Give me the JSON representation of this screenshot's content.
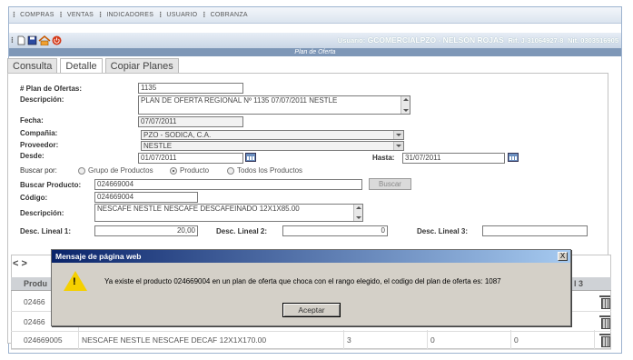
{
  "menu": [
    "COMPRAS",
    "VENTAS",
    "INDICADORES",
    "USUARIO",
    "COBRANZA"
  ],
  "toolbar": {
    "icons": [
      "new-document-icon",
      "save-icon",
      "home-icon",
      "power-icon"
    ]
  },
  "header": {
    "user_label": "Usuario:",
    "user": "GCOMERCIALPZO - NELSÓN ROJAS",
    "rif": "Rif. J-31064927-8",
    "nit": "Nit. 0303516905"
  },
  "page_title": "Plan de Oferta",
  "tabs": [
    "Consulta",
    "Detalle",
    "Copiar Planes"
  ],
  "form": {
    "plan_label": "# Plan de Ofertas:",
    "plan_value": "1135",
    "desc_label": "Descripción:",
    "desc_value": "PLAN DE OFERTA REGIONAL Nº 1135 07/07/2011 NESTLE",
    "fecha_label": "Fecha:",
    "fecha_value": "07/07/2011",
    "compania_label": "Compañia:",
    "compania_value": "PZO - SODICA, C.A.",
    "proveedor_label": "Proveedor:",
    "proveedor_value": "NESTLE",
    "desde_label": "Desde:",
    "desde_value": "01/07/2011",
    "hasta_label": "Hasta:",
    "hasta_value": "31/07/2011",
    "buscar_por_label": "Buscar por:",
    "radio_grupo": "Grupo de Productos",
    "radio_producto": "Producto",
    "radio_todos": "Todos los Productos",
    "buscar_prod_label": "Buscar Producto:",
    "buscar_prod_value": "024669004",
    "buscar_button": "Buscar",
    "codigo_label": "Código:",
    "codigo_value": "024669004",
    "desc2_label": "Descripción:",
    "desc2_value": "NESCAFE NESTLE NESCAFE DESCAFEINADO 12X1X85.00",
    "dl1_label": "Desc. Lineal 1:",
    "dl1_value": "20,00",
    "dl2_label": "Desc. Lineal 2:",
    "dl2_value": "0",
    "dl3_label": "Desc. Lineal 3:",
    "dl3_value": ""
  },
  "grid": {
    "nav_prev": "<",
    "nav_next": ">",
    "col_producto": "Produ",
    "col_l3": "l 3",
    "rows": [
      {
        "code": "02466",
        "desc": "",
        "a": "",
        "b": "",
        "c": ""
      },
      {
        "code": "02466",
        "desc": "",
        "a": "",
        "b": "",
        "c": ""
      },
      {
        "code": "024669005",
        "desc": "NESCAFE NESTLE NESCAFE DECAF 12X1X170.00",
        "a": "3",
        "b": "0",
        "c": "0"
      }
    ]
  },
  "dialog": {
    "title": "Mensaje de página web",
    "close": "X",
    "message": "Ya existe el producto 024669004 en un plan de oferta que choca con el rango elegido, el codigo del plan de oferta es: 1087",
    "ok": "Aceptar",
    "warn_mark": "!"
  }
}
